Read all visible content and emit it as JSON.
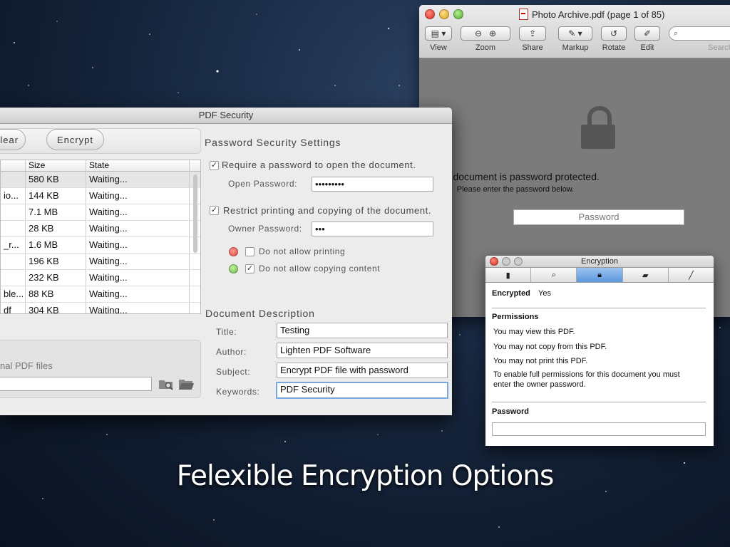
{
  "tagline": "Felexible Encryption Options",
  "preview": {
    "title": "Photo Archive.pdf (page 1 of 85)",
    "toolbar": [
      {
        "label": "View",
        "icon": "sidebar-icon"
      },
      {
        "label": "Zoom",
        "icon": "zoom-icon"
      },
      {
        "label": "Share",
        "icon": "share-icon"
      },
      {
        "label": "Markup",
        "icon": "markup-icon"
      },
      {
        "label": "Rotate",
        "icon": "rotate-icon"
      },
      {
        "label": "Edit",
        "icon": "edit-icon"
      }
    ],
    "search_label": "Search",
    "message": "This document is password protected.",
    "submessage": "Please enter the password below.",
    "password_placeholder": "Password"
  },
  "pdf_security": {
    "title": "PDF Security",
    "clear_label": "Clear",
    "encrypt_label": "Encrypt",
    "table": {
      "headers": [
        "",
        "Size",
        "State"
      ],
      "rows": [
        {
          "name": "",
          "size": "580 KB",
          "state": "Waiting..."
        },
        {
          "name": "io...",
          "size": "144 KB",
          "state": "Waiting..."
        },
        {
          "name": "",
          "size": "7.1 MB",
          "state": "Waiting..."
        },
        {
          "name": "",
          "size": "28 KB",
          "state": "Waiting..."
        },
        {
          "name": "_r...",
          "size": "1.6 MB",
          "state": "Waiting..."
        },
        {
          "name": "",
          "size": "196 KB",
          "state": "Waiting..."
        },
        {
          "name": "",
          "size": "232 KB",
          "state": "Waiting..."
        },
        {
          "name": "ble...",
          "size": "88 KB",
          "state": "Waiting..."
        },
        {
          "name": "df",
          "size": "304 KB",
          "state": "Waiting..."
        }
      ]
    },
    "output_label": "nal PDF files",
    "password_settings": {
      "heading": "Password Security Settings",
      "require_open": "Require a password to open the document.",
      "open_label": "Open Password:",
      "open_value": "•••••••••",
      "restrict": "Restrict printing and copying of the document.",
      "owner_label": "Owner Password:",
      "owner_value": "•••",
      "no_print": "Do not allow printing",
      "no_copy": "Do not allow copying content"
    },
    "description": {
      "heading": "Document Description",
      "title_label": "Title:",
      "title_value": "Testing",
      "author_label": "Author:",
      "author_value": "Lighten PDF Software",
      "subject_label": "Subject:",
      "subject_value": "Encrypt PDF file with password",
      "keywords_label": "Keywords:",
      "keywords_value": "PDF Security"
    }
  },
  "encryption": {
    "title": "Encryption",
    "tabs": [
      "document-icon",
      "search-icon",
      "lock-icon",
      "ruler-icon",
      "pen-icon"
    ],
    "encrypted_label": "Encrypted",
    "encrypted_value": "Yes",
    "permissions_heading": "Permissions",
    "perm1": "You may view this PDF.",
    "perm2": "You may not copy from this PDF.",
    "perm3": "You may not print this PDF.",
    "perm4": "To enable full permissions for this document you must",
    "perm5": "enter the owner password.",
    "password_heading": "Password"
  },
  "colors": {
    "accent_blue": "#5b96dd",
    "red_bullet": "#e24b43",
    "green_bullet": "#6cc04a"
  }
}
